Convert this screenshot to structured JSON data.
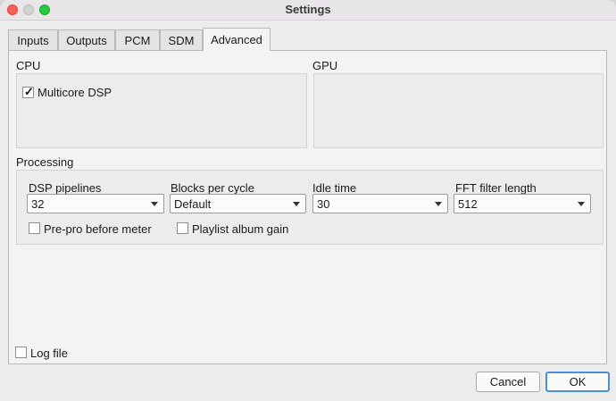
{
  "window": {
    "title": "Settings"
  },
  "tabs": [
    {
      "label": "Inputs",
      "active": false
    },
    {
      "label": "Outputs",
      "active": false
    },
    {
      "label": "PCM",
      "active": false
    },
    {
      "label": "SDM",
      "active": false
    },
    {
      "label": "Advanced",
      "active": true
    }
  ],
  "cpu": {
    "label": "CPU",
    "multicore": {
      "label": "Multicore DSP",
      "checked": true
    }
  },
  "gpu": {
    "label": "GPU"
  },
  "processing": {
    "label": "Processing",
    "fields": [
      {
        "label": "DSP pipelines",
        "value": "32"
      },
      {
        "label": "Blocks per cycle",
        "value": "Default"
      },
      {
        "label": "Idle time",
        "value": "30"
      },
      {
        "label": "FFT filter length",
        "value": "512"
      }
    ],
    "prepro": {
      "label": "Pre-pro before meter",
      "checked": false
    },
    "playlist_gain": {
      "label": "Playlist album gain",
      "checked": false
    }
  },
  "log_file": {
    "label": "Log file",
    "checked": false
  },
  "buttons": {
    "cancel": "Cancel",
    "ok": "OK"
  },
  "colors": {
    "accent": "#4a90d9",
    "close": "#fe5f57",
    "maximize": "#28c840"
  }
}
